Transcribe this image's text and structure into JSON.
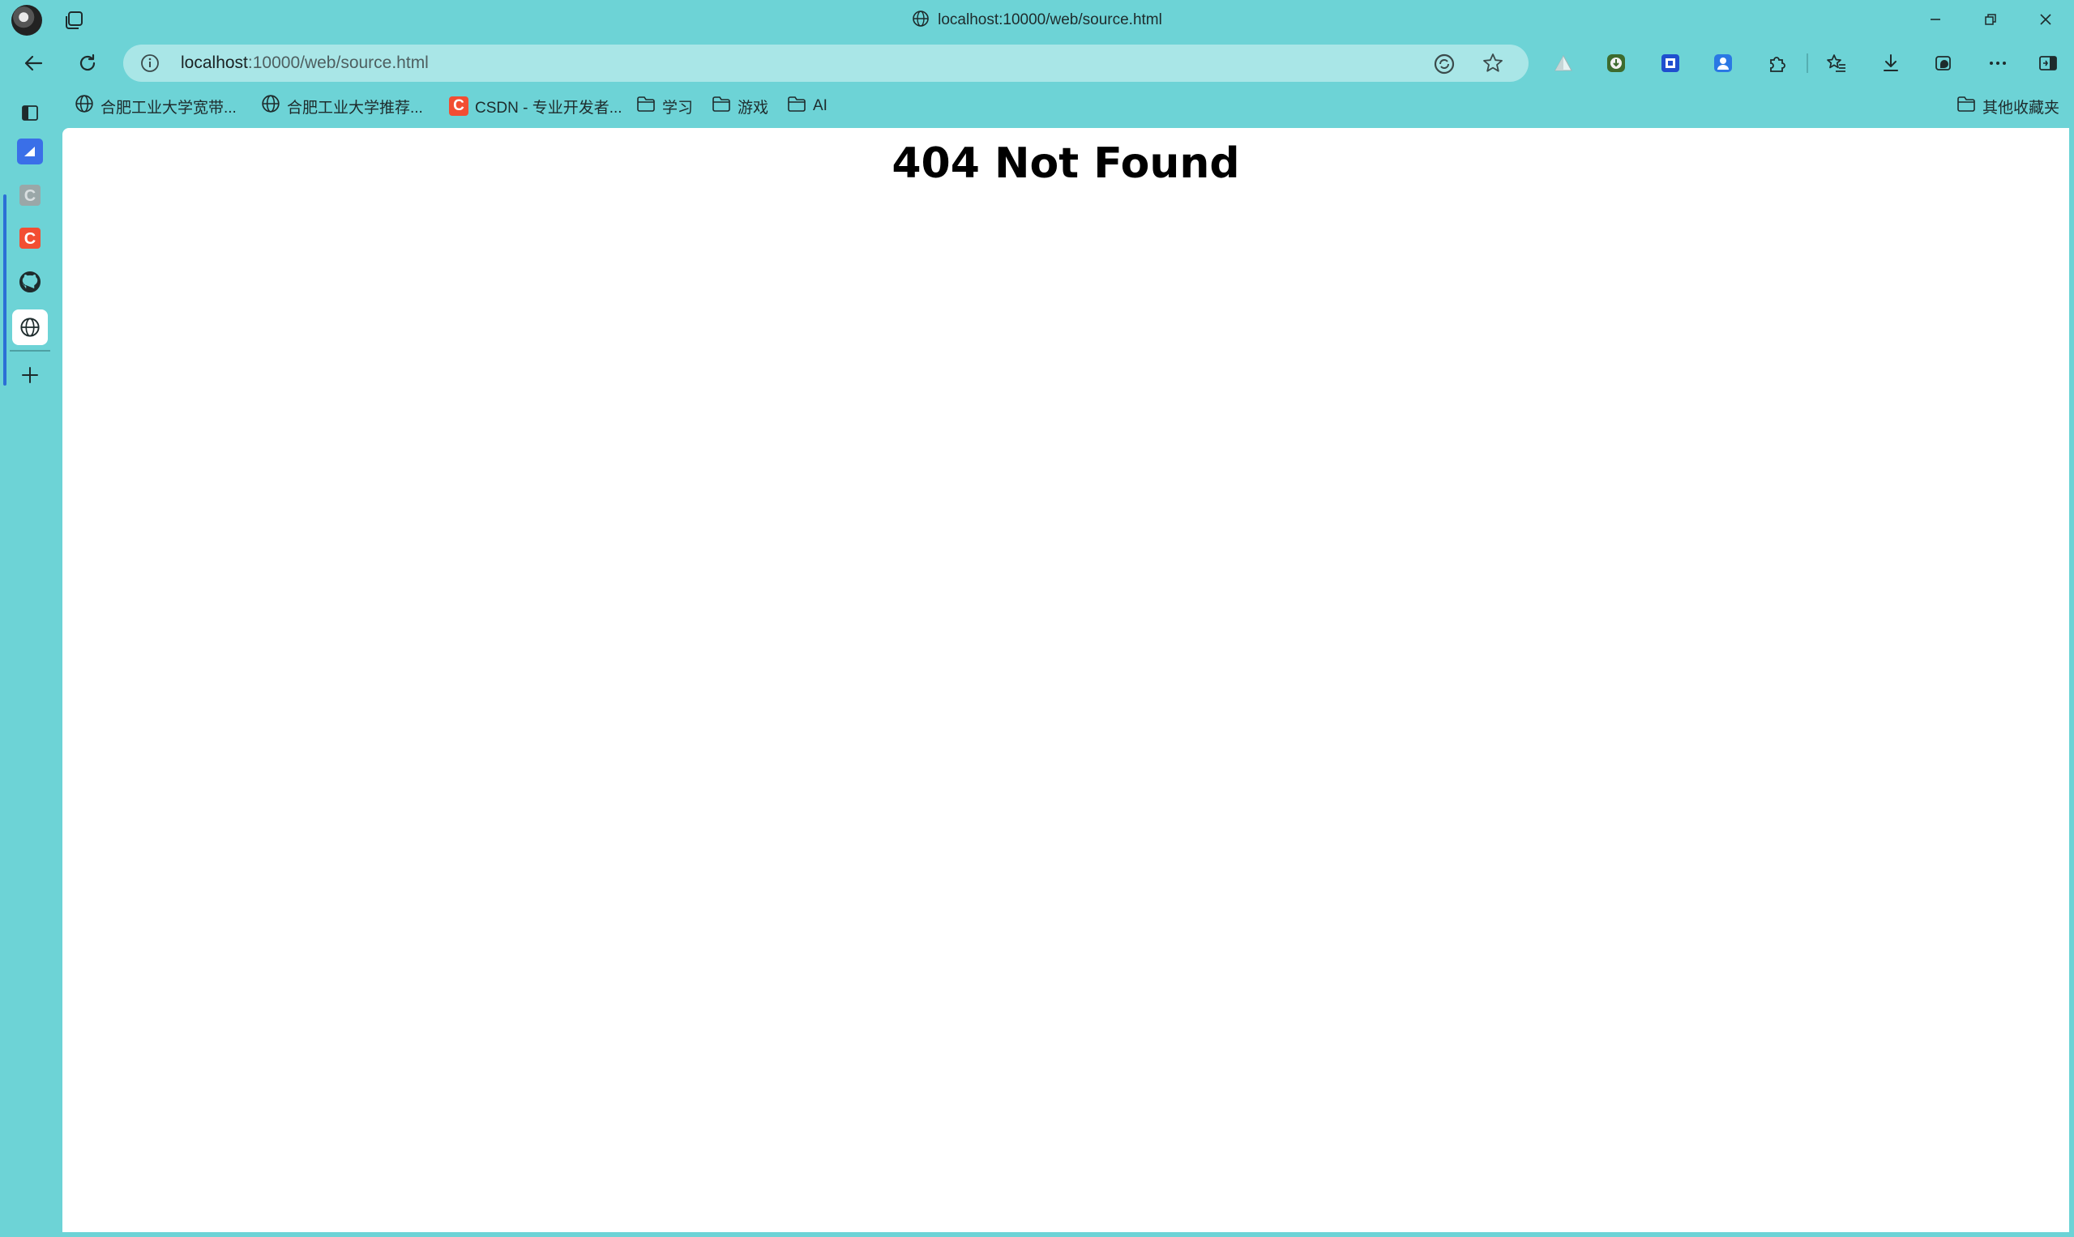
{
  "window": {
    "title": "localhost:10000/web/source.html"
  },
  "address_bar": {
    "host": "localhost",
    "path": ":10000/web/source.html"
  },
  "bookmarks": [
    {
      "label": "合肥工业大学宽带...",
      "icon": "globe-icon"
    },
    {
      "label": "合肥工业大学推荐...",
      "icon": "globe-icon"
    },
    {
      "label": "CSDN - 专业开发者...",
      "icon": "csdn-icon"
    },
    {
      "label": "学习",
      "icon": "folder-icon"
    },
    {
      "label": "游戏",
      "icon": "folder-icon"
    },
    {
      "label": "AI",
      "icon": "folder-icon"
    }
  ],
  "other_bookmarks": {
    "label": "其他收藏夹",
    "icon": "folder-icon"
  },
  "sidebar": {
    "items": [
      {
        "icon": "blue-app-icon"
      },
      {
        "icon": "csdn-gray-icon"
      },
      {
        "icon": "csdn-icon"
      },
      {
        "icon": "github-icon"
      },
      {
        "icon": "globe-icon"
      },
      {
        "icon": "plus-icon"
      }
    ],
    "csdn_letter": "C"
  },
  "page": {
    "heading": "404 Not Found"
  },
  "colors": {
    "chrome": "#6dd3d6",
    "address_bar": "#a9e6e7",
    "csdn": "#f24e32",
    "accent": "#2b6fd6"
  }
}
